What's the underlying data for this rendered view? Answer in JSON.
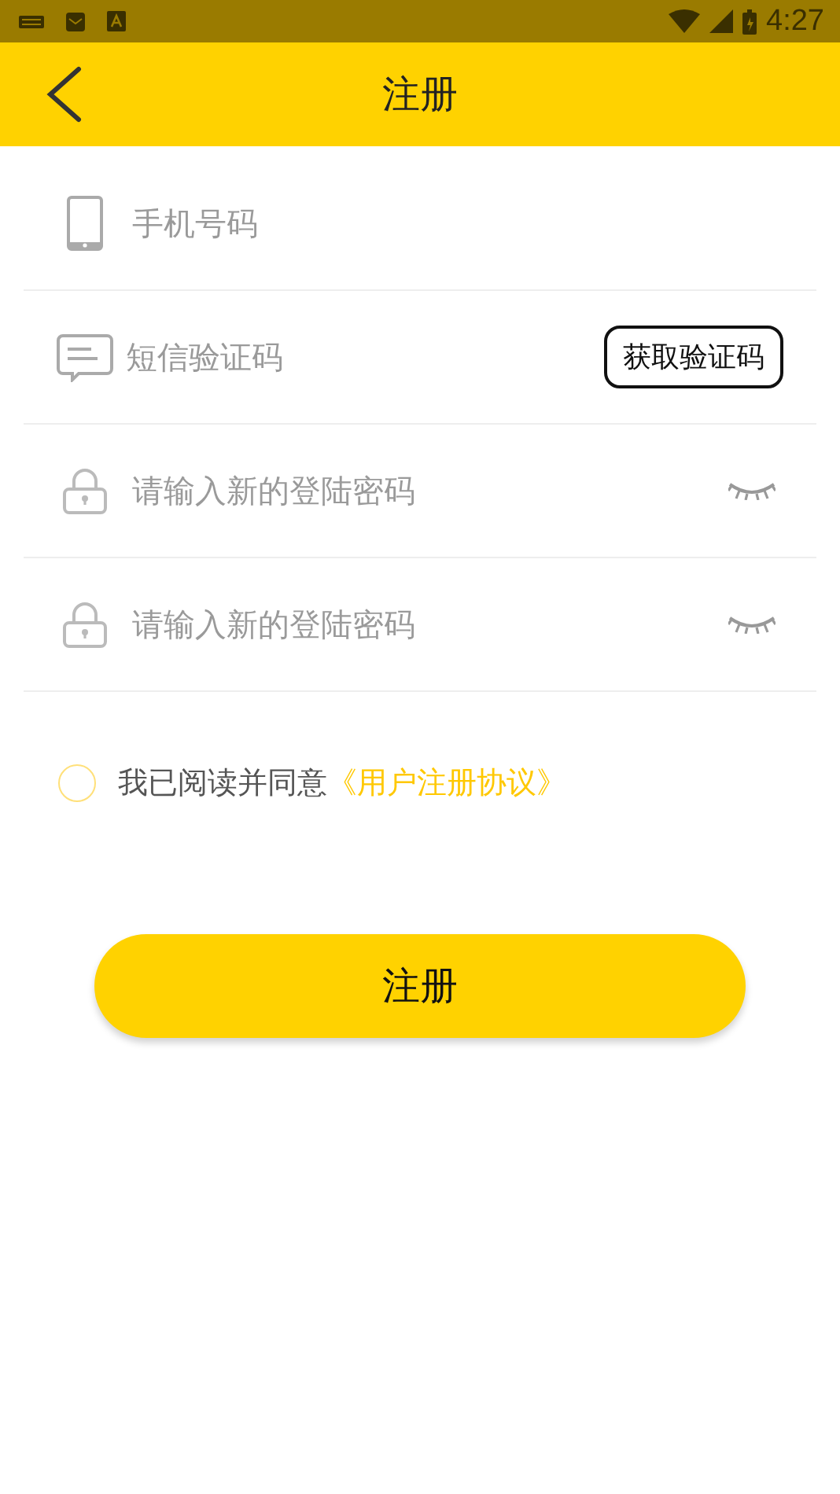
{
  "status_bar": {
    "time": "4:27"
  },
  "header": {
    "title": "注册"
  },
  "fields": [
    {
      "kind": "phone",
      "placeholder": "手机号码"
    },
    {
      "kind": "sms",
      "placeholder": "短信验证码",
      "button": "获取验证码"
    },
    {
      "kind": "password",
      "placeholder": "请输入新的登陆密码"
    },
    {
      "kind": "password",
      "placeholder": "请输入新的登陆密码"
    }
  ],
  "agreement": {
    "checked": false,
    "text": "我已阅读并同意",
    "link": "《用户注册协议》"
  },
  "submit_button": "注册"
}
